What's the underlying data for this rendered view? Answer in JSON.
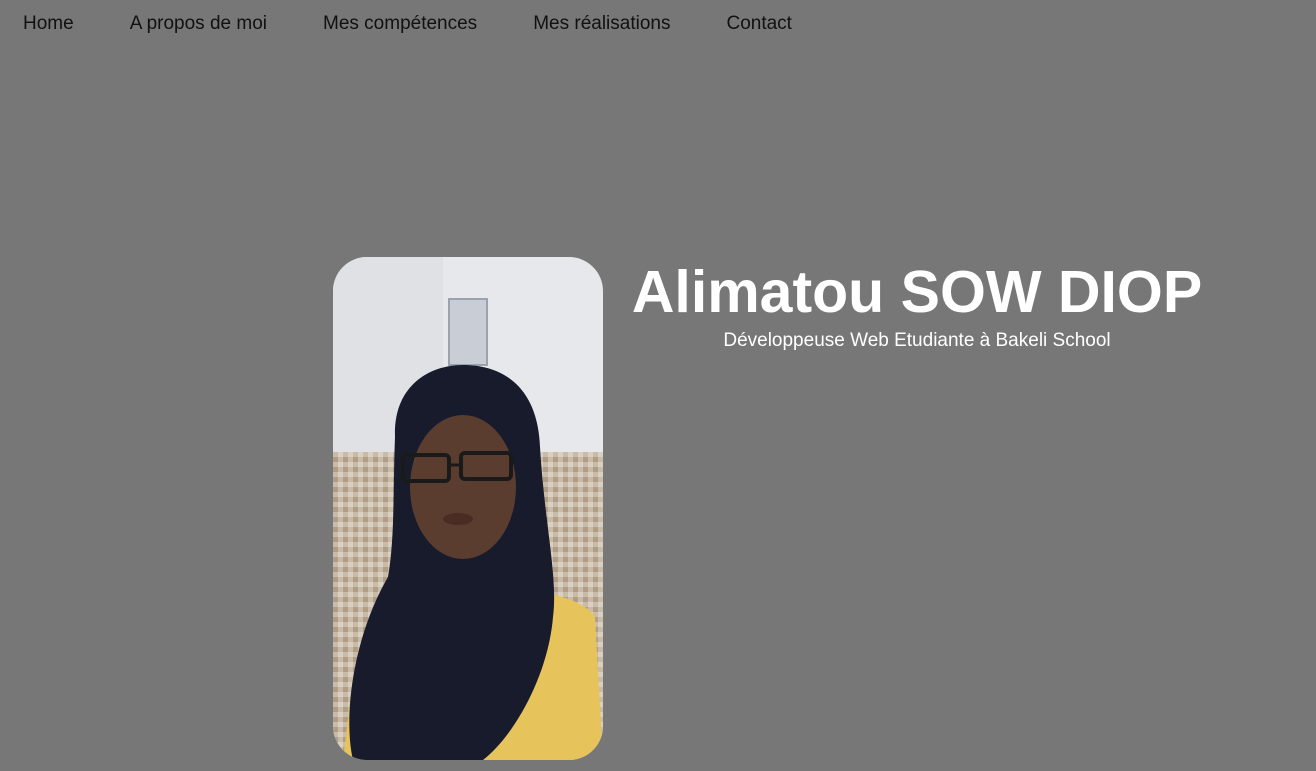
{
  "nav": {
    "items": [
      {
        "label": "Home"
      },
      {
        "label": "A propos de moi"
      },
      {
        "label": "Mes compétences"
      },
      {
        "label": "Mes réalisations"
      },
      {
        "label": "Contact"
      }
    ]
  },
  "hero": {
    "name": "Alimatou SOW DIOP",
    "subtitle": "Développeuse Web Etudiante à Bakeli School",
    "photo_alt": "Alimatou SOW DIOP"
  },
  "colors": {
    "background": "#777777",
    "nav_text": "#111111",
    "hero_text": "#ffffff"
  }
}
